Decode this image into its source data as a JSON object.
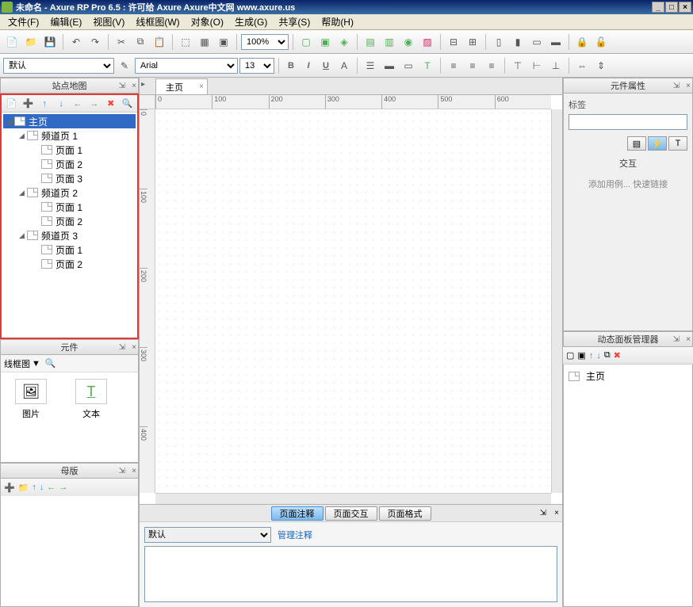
{
  "titlebar": {
    "text": "未命名 - Axure RP Pro 6.5 : 许可给 Axure Axure中文网 www.axure.us"
  },
  "menu": [
    "文件(F)",
    "编辑(E)",
    "视图(V)",
    "线框图(W)",
    "对象(O)",
    "生成(G)",
    "共享(S)",
    "帮助(H)"
  ],
  "zoom": "100%",
  "font_default": "默认",
  "font_family": "Arial",
  "font_size": "13",
  "panels": {
    "sitemap": "站点地图",
    "widgets": "元件",
    "masters": "母版",
    "props": "元件属性",
    "dp": "动态面板管理器"
  },
  "tree": {
    "root": "主页",
    "nodes": [
      {
        "label": "频道页 1",
        "children": [
          "页面 1",
          "页面 2",
          "页面 3"
        ]
      },
      {
        "label": "频道页 2",
        "children": [
          "页面 1",
          "页面 2"
        ]
      },
      {
        "label": "频道页 3",
        "children": [
          "页面 1",
          "页面 2"
        ]
      }
    ]
  },
  "widgets_lib": {
    "label": "线框图",
    "items": [
      "图片",
      "文本"
    ]
  },
  "tab": "主页",
  "ruler_h": [
    "0",
    "100",
    "200",
    "300",
    "400",
    "500",
    "600"
  ],
  "ruler_v": [
    "0",
    "100",
    "200",
    "300",
    "400"
  ],
  "bottom_tabs": [
    "页面注释",
    "页面交互",
    "页面格式"
  ],
  "bottom": {
    "select": "默认",
    "link": "管理注释"
  },
  "props": {
    "label": "标签",
    "section": "交互",
    "link1": "添加用例...",
    "link2": "快速链接"
  },
  "dp_item": "主页"
}
